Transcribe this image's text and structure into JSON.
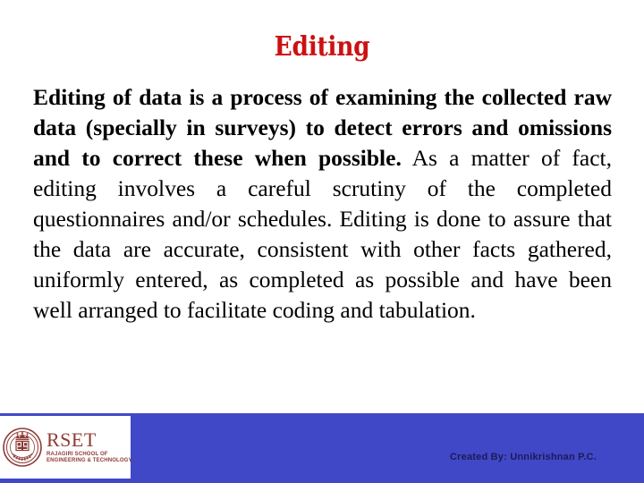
{
  "slide": {
    "title": "Editing",
    "title_color": "#cc1111",
    "background_color": "#ffffff",
    "body": {
      "bold_lead": "Editing of data is a process of examining the collected raw data (specially in surveys) to detect errors and omissions and to correct these when possible.",
      "regular_rest": " As a matter of fact, editing involves a careful scrutiny of the completed questionnaires and/or schedules. Editing is done to assure that the data are accurate, consistent with other facts gathered, uniformly entered, as completed as possible and have been well arranged to facilitate coding and tabulation."
    }
  },
  "footer": {
    "bar_color": "#4048c8",
    "logo": {
      "acronym": "RSET",
      "full_name_line1": "RAJAGIRI SCHOOL OF",
      "full_name_line2": "ENGINEERING & TECHNOLOGY",
      "seal_text": "RAJAGIRI",
      "seal_color": "#8e3b36"
    },
    "credit": "Created By: Unnikrishnan P.C."
  }
}
